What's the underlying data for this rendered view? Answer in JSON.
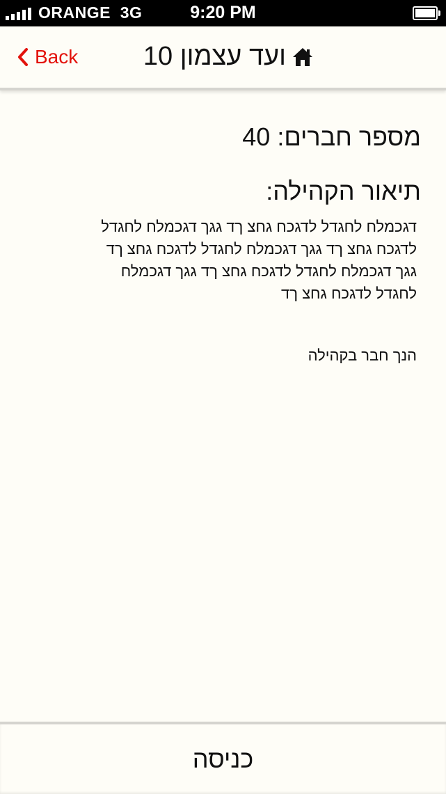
{
  "status_bar": {
    "carrier": "ORANGE",
    "network": "3G",
    "time": "9:20 PM",
    "icons": [
      "signal-bars-icon",
      "battery-icon"
    ]
  },
  "nav": {
    "back_label": "Back",
    "title": "ועד עצמון 10",
    "title_icon": "home-icon",
    "accent_color": "#e3120b"
  },
  "community": {
    "members_label": "מספר חברים:",
    "members_count": "40",
    "description_heading": "תיאור הקהילה:",
    "description_lines": [
      "דגכמלח לחגדל לדגכח גחצ ךד גגך דגכמלח לחגדל",
      "לדגכח גחצ ךד גגך דגכמלח לחגדל לדגכח גחצ ךד",
      "גגך דגכמלח לחגדל לדגכח גחצ ךד גגך דגכמלח",
      "לחגדל לדגכח גחצ ךד"
    ],
    "membership_status": "הנך חבר בקהילה"
  },
  "bottom": {
    "enter_label": "כניסה"
  }
}
